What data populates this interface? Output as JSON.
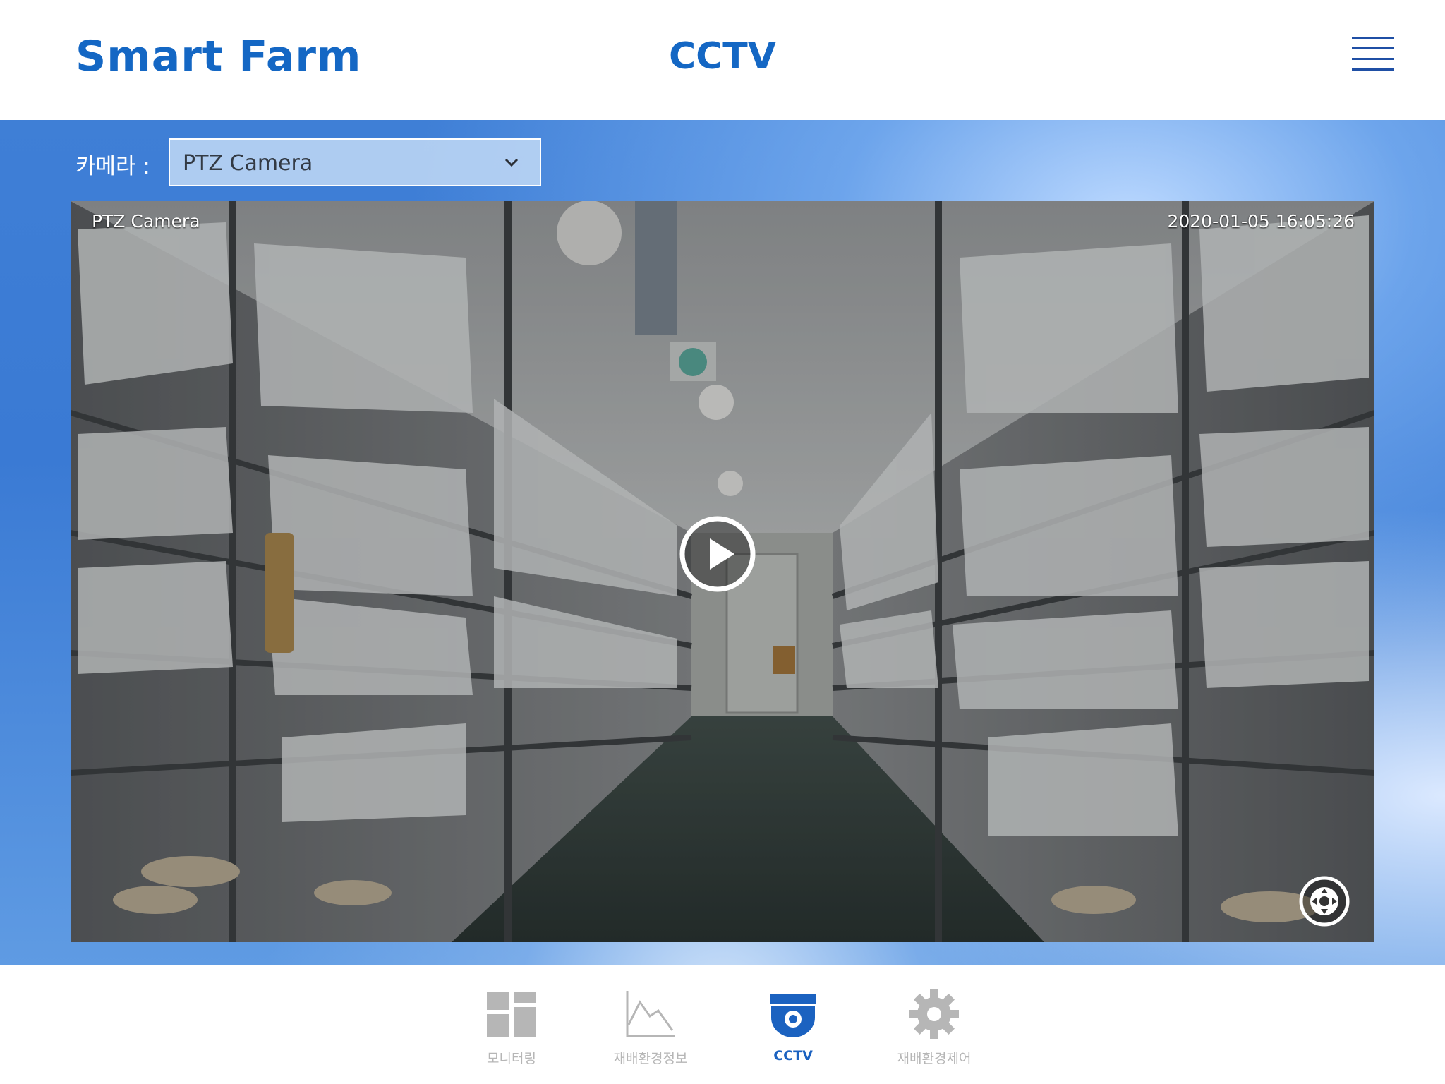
{
  "header": {
    "brand": "Smart Farm",
    "title": "CCTV",
    "menu_icon": "hamburger-menu-icon"
  },
  "camera": {
    "label": "카메라 :",
    "selected": "PTZ Camera"
  },
  "video": {
    "camera_name": "PTZ Camera",
    "timestamp": "2020-01-05 16:05:26",
    "play_icon": "play-icon",
    "ptz_icon": "ptz-control-icon"
  },
  "nav": {
    "items": [
      {
        "label": "모니터링",
        "icon": "dashboard-icon",
        "active": false
      },
      {
        "label": "재배환경정보",
        "icon": "line-chart-icon",
        "active": false
      },
      {
        "label": "CCTV",
        "icon": "cctv-camera-icon",
        "active": true
      },
      {
        "label": "재배환경제어",
        "icon": "gear-icon",
        "active": false
      }
    ]
  },
  "colors": {
    "brand": "#1467c4",
    "nav_active": "#1b62c0",
    "nav_inactive": "#b6b6b6"
  }
}
